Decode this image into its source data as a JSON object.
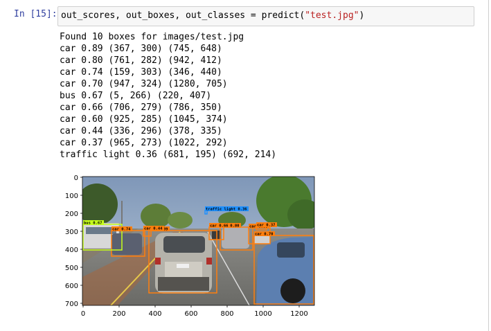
{
  "cell": {
    "prompt": "In [15]:",
    "code": {
      "before": "out_scores, out_boxes, out_classes = predict(",
      "string": "\"test.jpg\"",
      "after": ")"
    }
  },
  "output": {
    "header": "Found 10 boxes for images/test.jpg",
    "detections": [
      "car 0.89 (367, 300) (745, 648)",
      "car 0.80 (761, 282) (942, 412)",
      "car 0.74 (159, 303) (346, 440)",
      "car 0.70 (947, 324) (1280, 705)",
      "bus 0.67 (5, 266) (220, 407)",
      "car 0.66 (706, 279) (786, 350)",
      "car 0.60 (925, 285) (1045, 374)",
      "car 0.44 (336, 296) (378, 335)",
      "car 0.37 (965, 273) (1022, 292)",
      "traffic light 0.36 (681, 195) (692, 214)"
    ]
  },
  "plot": {
    "x_ticks": [
      "0",
      "200",
      "400",
      "600",
      "800",
      "1000",
      "1200"
    ],
    "y_ticks": [
      "0",
      "100",
      "200",
      "300",
      "400",
      "500",
      "600",
      "700"
    ],
    "box_labels": [
      {
        "text": "car 0.89",
        "color": "#ff7f0e"
      },
      {
        "text": "car 0.80",
        "color": "#ff7f0e"
      },
      {
        "text": "car 0.74",
        "color": "#ff7f0e"
      },
      {
        "text": "car 0.70",
        "color": "#ff7f0e"
      },
      {
        "text": "bus 0.67",
        "color": "#c6ff1a"
      },
      {
        "text": "car 0.66",
        "color": "#ff7f0e"
      },
      {
        "text": "car 0.60",
        "color": "#ff7f0e"
      },
      {
        "text": "car 0.44",
        "color": "#ff7f0e"
      },
      {
        "text": "car 0.37",
        "color": "#ff7f0e"
      },
      {
        "text": "traffic light 0.36",
        "color": "#1e90ff"
      }
    ]
  }
}
